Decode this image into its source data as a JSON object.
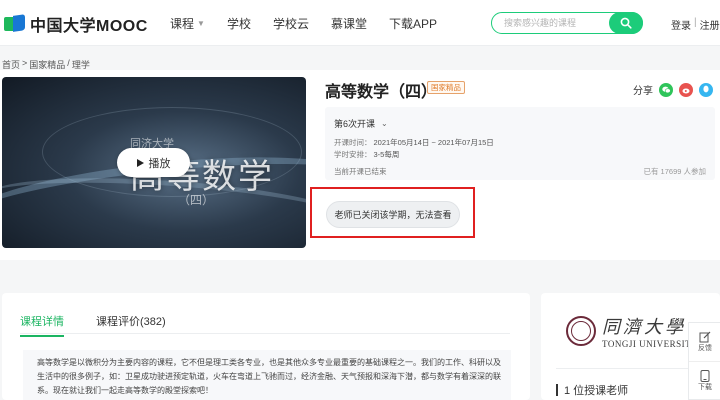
{
  "header": {
    "logo_text": "中国大学MOOC",
    "nav": [
      {
        "label": "课程",
        "has_caret": true
      },
      {
        "label": "学校"
      },
      {
        "label": "学校云"
      },
      {
        "label": "慕课堂"
      },
      {
        "label": "下载APP"
      }
    ],
    "search_placeholder": "搜索感兴趣的课程",
    "login": "登录",
    "separator": "|",
    "register": "注册"
  },
  "breadcrumb": [
    "首页",
    "国家精品",
    "理学"
  ],
  "course": {
    "title": "高等数学（四）",
    "badge": "国家精品",
    "play_label": "播放",
    "cover_title": "高等数学",
    "cover_sub": "（四）",
    "cover_uni": "同济大学",
    "share_label": "分享",
    "term_label": "第6次开课",
    "time_label": "开课时间：",
    "time_value": "2021年05月14日 ~ 2021年07月15日",
    "hours_label": "学时安排：",
    "hours_value": "3-5每周",
    "status": "当前开课已结束",
    "enrolled": "已有 17699 人参加",
    "closed_notice": "老师已关闭该学期，无法查看"
  },
  "tabs": [
    {
      "label": "课程详情",
      "active": true
    },
    {
      "label": "课程评价(382)",
      "active": false
    }
  ],
  "description": "高等数学是以微积分为主要内容的课程，它不但是理工类各专业，也是其他众多专业最重要的基础课程之一。我们的工作、科研以及生活中的很多例子，如：卫星成功驶进预定轨道，火车在弯道上飞驰而过，经济金融、天气预报和深海下潜，都与数学有着深深的联系。现在就让我们一起走高等数学的殿堂探索吧！",
  "school": {
    "name_cn": "同濟大學",
    "name_en": "TONGJI UNIVERSITY",
    "teachers": "1 位授课老师"
  },
  "tools": {
    "feedback": "反馈",
    "download": "下载"
  },
  "colors": {
    "brand_green": "#1ccc7a",
    "tab_active": "#1cb562",
    "highlight_red": "#e02020"
  }
}
